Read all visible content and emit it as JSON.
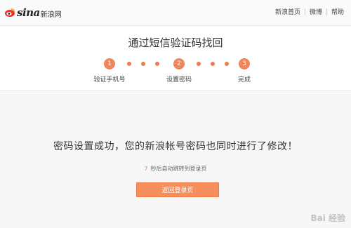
{
  "header": {
    "logo": {
      "brand_text": "sina",
      "cn_text": "新浪网"
    },
    "links": [
      "新浪首页",
      "微博",
      "帮助"
    ]
  },
  "title": "通过短信验证码找回",
  "steps": [
    {
      "number": "1",
      "label": "验证手机号"
    },
    {
      "number": "2",
      "label": "设置密码"
    },
    {
      "number": "3",
      "label": "完成"
    }
  ],
  "accent_color": "#f0865a",
  "main": {
    "success_message": "密码设置成功，您的新浪帐号密码也同时进行了修改！",
    "countdown": "7",
    "redirect_text": "秒后自动跳转到登录页",
    "back_button_label": "返回登录页"
  },
  "watermark": {
    "text": "Bai 经验"
  }
}
